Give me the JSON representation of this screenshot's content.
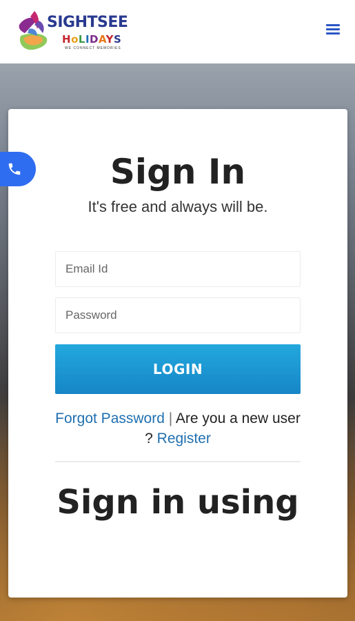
{
  "header": {
    "brand": "SIGHTSEE",
    "brand_sub": [
      "H",
      "o",
      "L",
      "I",
      "D",
      "A",
      "Y",
      "S"
    ],
    "tagline": "WE CONNECT MEMORIES",
    "menu_icon": "hamburger-icon"
  },
  "call": {
    "icon": "phone-icon"
  },
  "signin": {
    "title": "Sign In",
    "subtitle": "It's free and always will be.",
    "email_placeholder": "Email Id",
    "password_placeholder": "Password",
    "login_label": "LOGIN",
    "forgot_label": "Forgot Password",
    "separator": "|",
    "new_user_text": "Are you a new user ?",
    "register_label": "Register",
    "using_title": "Sign in using"
  },
  "colors": {
    "accent": "#1e97d4",
    "link": "#1f6fb0",
    "call_button": "#2f6df0",
    "brand": "#2a3a8f"
  }
}
